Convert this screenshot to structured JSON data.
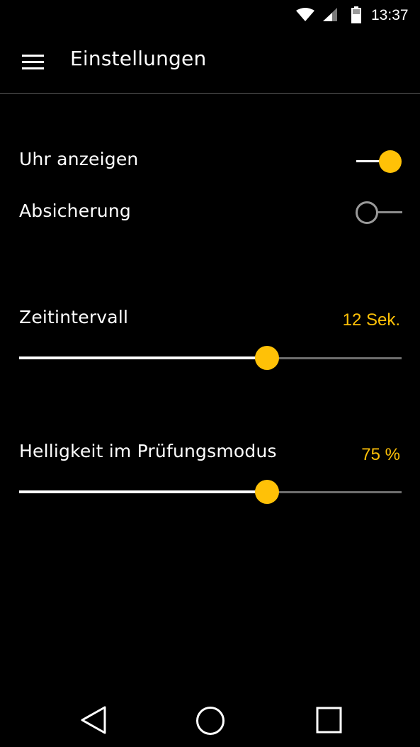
{
  "status_bar": {
    "time": "13:37",
    "icons": [
      "wifi-icon",
      "cell-signal-icon",
      "battery-icon"
    ]
  },
  "app_bar": {
    "menu_icon": "menu-icon",
    "title": "Einstellungen"
  },
  "settings": {
    "show_clock": {
      "label": "Uhr anzeigen",
      "on": true
    },
    "lock": {
      "label": "Absicherung",
      "on": false
    },
    "interval": {
      "label": "Zeitintervall",
      "value": "12 Sek.",
      "fraction": 0.648
    },
    "brightness": {
      "label": "Helligkeit im Prüfungsmodus",
      "value": "75 %",
      "fraction": 0.648
    }
  },
  "nav_bar": {
    "icons": [
      "back-icon",
      "home-icon",
      "recents-icon"
    ]
  },
  "colors": {
    "accent": "#ffc107",
    "background": "#000000",
    "text": "#ffffff",
    "divider": "#5a5a5a"
  }
}
